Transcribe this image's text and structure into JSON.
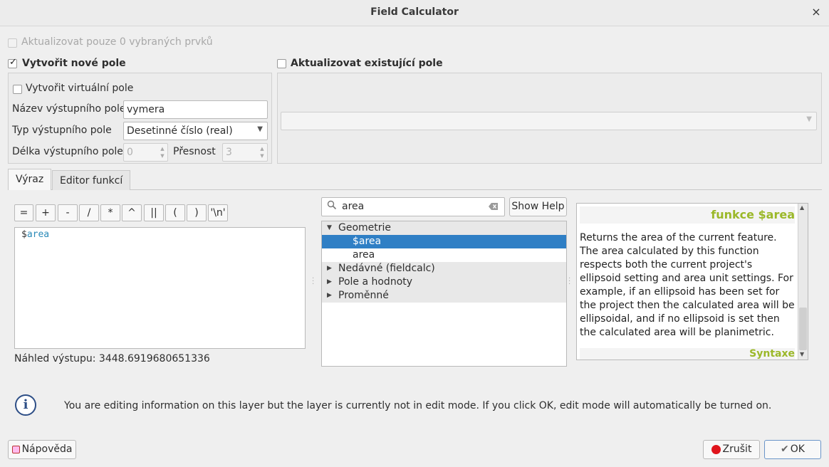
{
  "window": {
    "title": "Field Calculator",
    "close_glyph": "×"
  },
  "top": {
    "update_selected_label": "Aktualizovat pouze 0 vybraných prvků",
    "create_new_field_label": "Vytvořit nové pole",
    "create_new_field_checked": true,
    "update_existing_label": "Aktualizovat existující pole",
    "update_existing_checked": false
  },
  "new_field": {
    "virtual_label": "Vytvořit virtuální pole",
    "name_label": "Název výstupního pole",
    "name_value": "vymera",
    "type_label": "Typ výstupního pole",
    "type_value": "Desetinné číslo (real)",
    "length_label": "Délka výstupního pole",
    "length_value": "0",
    "precision_label": "Přesnost",
    "precision_value": "3"
  },
  "tabs": [
    {
      "label": "Výraz",
      "active": true
    },
    {
      "label": "Editor funkcí",
      "active": false
    }
  ],
  "operators": [
    "=",
    "+",
    "-",
    "/",
    "*",
    "^",
    "||",
    "(",
    ")",
    "'\\n'"
  ],
  "expression": {
    "prefix": "$",
    "identifier": "area"
  },
  "preview": {
    "text": "Náhled výstupu: 3448.6919680651336"
  },
  "search": {
    "value": "area",
    "show_help_label": "Show Help"
  },
  "tree": {
    "geometry_label": "Geometrie",
    "selected_item": "$area",
    "item2": "area",
    "recent_label": "Nedávné (fieldcalc)",
    "fields_label": "Pole a hodnoty",
    "vars_label": "Proměnné"
  },
  "help": {
    "title": "funkce $area",
    "body": "Returns the area of the current feature. The area calculated by this function respects both the current project's ellipsoid setting and area unit settings. For example, if an ellipsoid has been set for the project then the calculated area will be ellipsoidal, and if no ellipsoid is set then the calculated area will be planimetric.",
    "syntax_label": "Syntaxe"
  },
  "info": {
    "icon": "info-icon",
    "message": "You are editing information on this layer but the layer is currently not in edit mode. If you click OK, edit mode will automatically be turned on."
  },
  "buttons": {
    "help_label": "Nápověda",
    "cancel_label": "Zrušit",
    "ok_label": "OK"
  },
  "colors": {
    "selection": "#2f7fc5",
    "help_accent": "#9bb829",
    "identifier": "#2a8ab8"
  }
}
